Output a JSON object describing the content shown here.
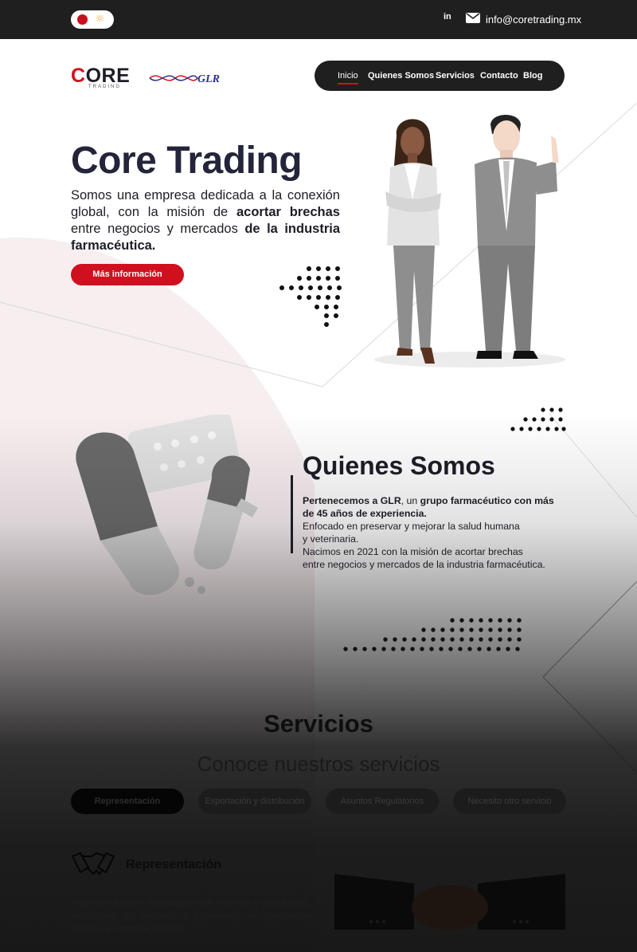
{
  "topbar": {
    "linkedin_icon": "in",
    "email": "info@coretrading.mx"
  },
  "header": {
    "logo_core_prefix": "C",
    "logo_core_rest": "ORE",
    "logo_trading": "TRADING",
    "logo_glr": "GLR",
    "nav": [
      {
        "label": "Inicio",
        "active": true
      },
      {
        "label": "Quienes Somos"
      },
      {
        "label": "Servicios"
      },
      {
        "label": "Contacto"
      },
      {
        "label": "Blog"
      }
    ]
  },
  "hero": {
    "title": "Core Trading",
    "text_1": "Somos una empresa dedicada a la conexión global, con la misión de ",
    "text_2": "acortar brechas",
    "text_3": " entre negocios y mercados ",
    "text_4": "de la industria farmacéutica.",
    "button": "Más información"
  },
  "about": {
    "title": "Quienes Somos",
    "p1_a": "Pertenecemos a GLR",
    "p1_b": ", un ",
    "p1_c": "grupo farmacéutico con más",
    "p1_d": "de 45 años de experiencia.",
    "p2_a": "Enfocado en preservar y mejorar la salud humana",
    "p2_b": "y veterinaria.",
    "p3_a": "Nacimos en 2021 con la misión de acortar brechas",
    "p3_b": "entre negocios y mercados de la industria farmacéutica."
  },
  "services": {
    "title": "Servicios",
    "subtitle": "Conoce nuestros servicios",
    "tabs": [
      {
        "label": "Representación",
        "active": true
      },
      {
        "label": "Exportación y distribución"
      },
      {
        "label": "Asuntos Regulatorios"
      },
      {
        "label": "Necesito otro servicio"
      }
    ],
    "current_title": "Representación",
    "current_text": "Representación estratégica de marcas y productos, facilitando su entrada y expansión en mercados locales e internacionales."
  },
  "colors": {
    "brand_red": "#d0101f",
    "dark": "#1f1f1f"
  }
}
